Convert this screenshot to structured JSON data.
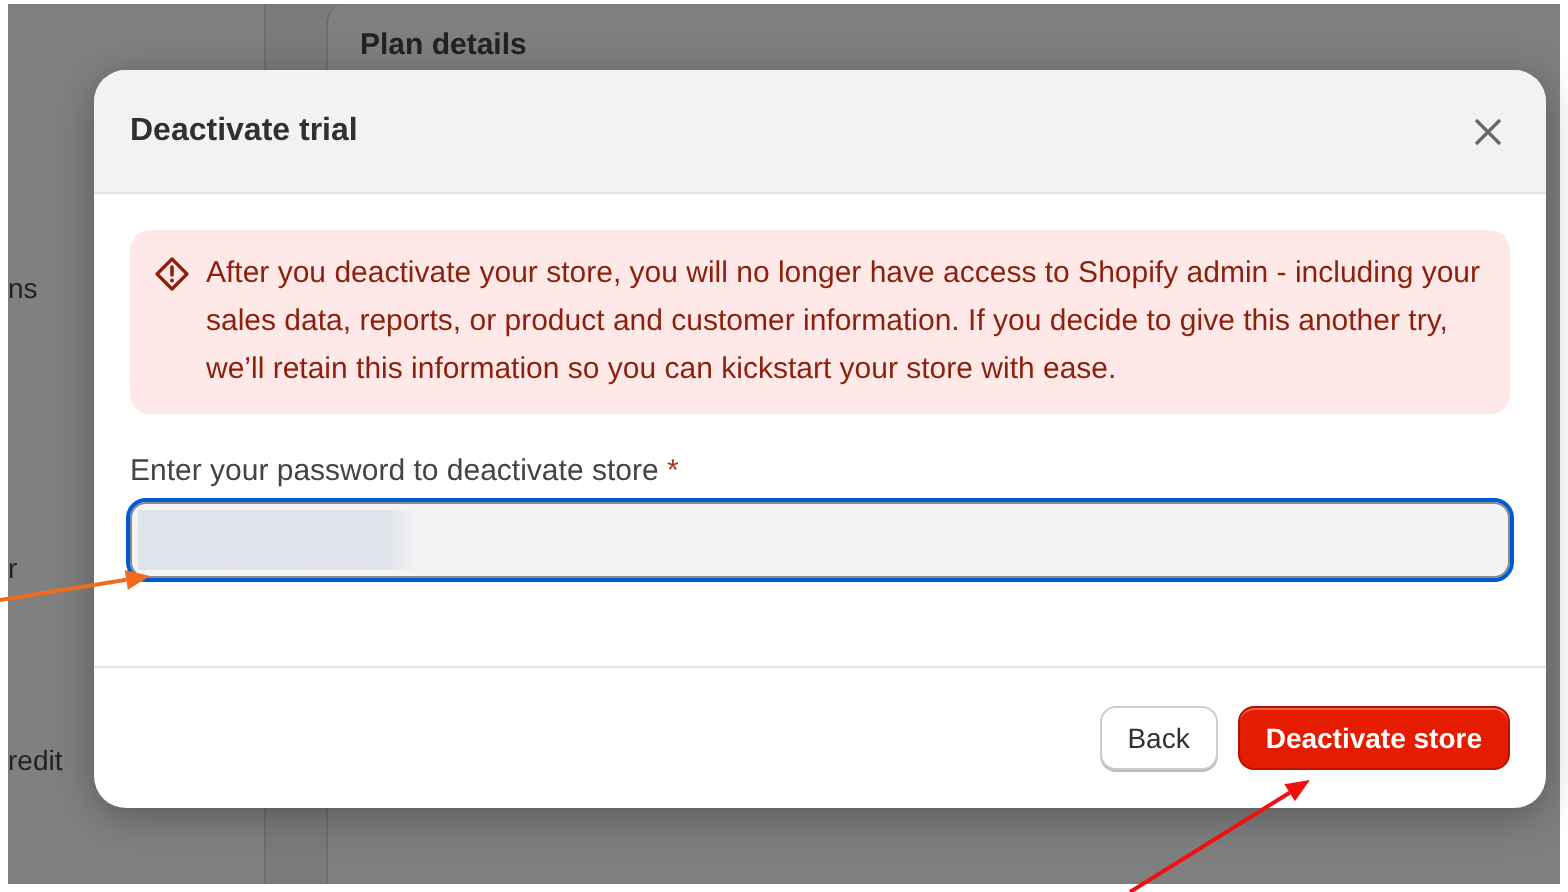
{
  "background": {
    "sidebar_items": [
      "ns",
      "r",
      "redit"
    ],
    "card_title": "Plan details"
  },
  "dialog": {
    "title": "Deactivate trial",
    "alert": {
      "kind": "critical",
      "text": "After you deactivate your store, you will no longer have access to Shopify admin - including your sales data, reports, or product and customer information. If you decide to give this another try, we’ll retain this information so you can kickstart your store with ease."
    },
    "password_field": {
      "label": "Enter your password to deactivate store",
      "required_mark": "*",
      "focused": true,
      "redacted": true
    },
    "buttons": [
      {
        "label": "Back",
        "kind": "secondary"
      },
      {
        "label": "Deactivate store",
        "kind": "critical"
      }
    ]
  },
  "annotations": [
    {
      "kind": "arrow",
      "color": "#f26b1d"
    },
    {
      "kind": "arrow",
      "color": "#f01010"
    }
  ]
}
